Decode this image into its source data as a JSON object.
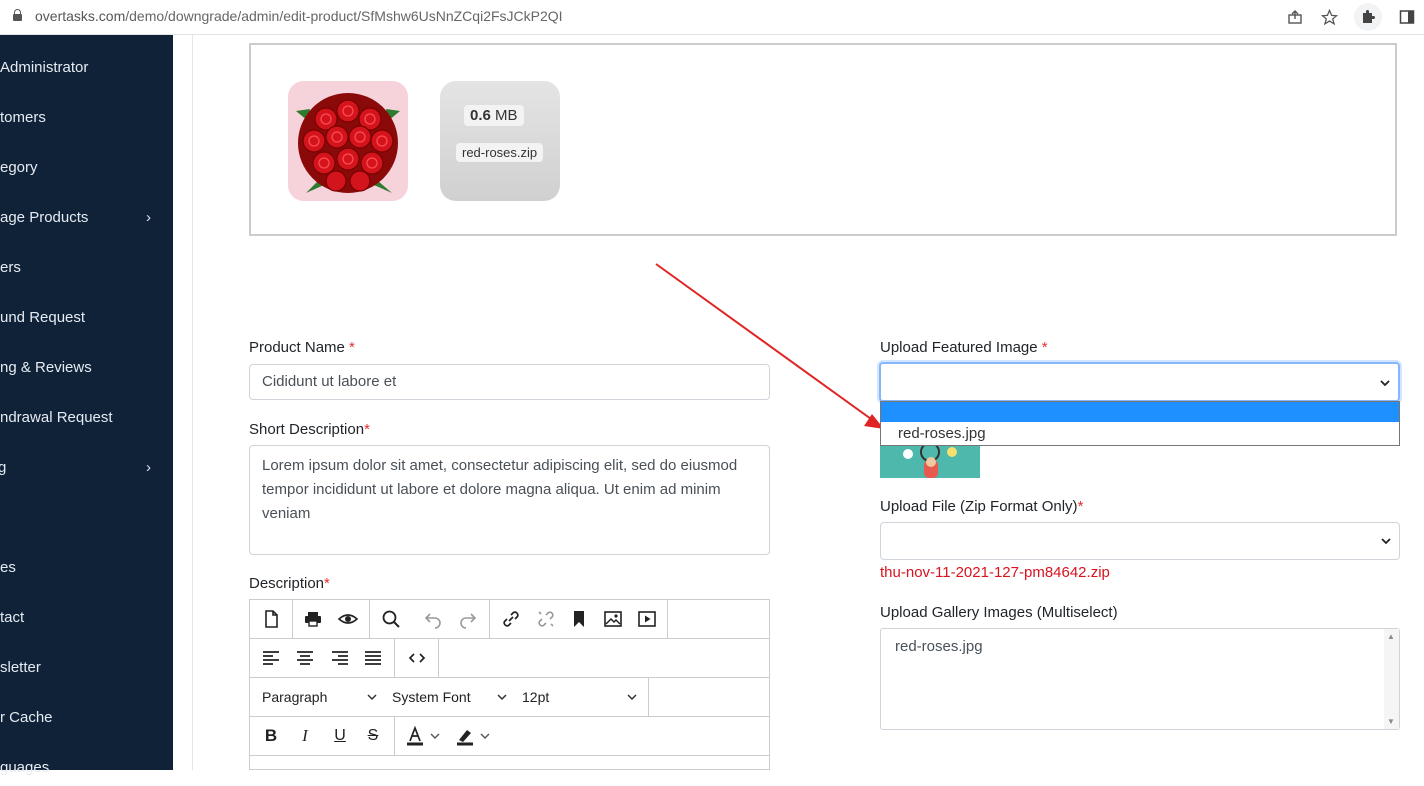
{
  "browser": {
    "url_host": "overtasks.com",
    "url_path": "/demo/downgrade/admin/edit-product/SfMshw6UsNnZCqi2FsJCkP2QI"
  },
  "sidebar": {
    "items": [
      {
        "label": "Administrator"
      },
      {
        "label": "tomers"
      },
      {
        "label": "egory"
      },
      {
        "label": "age Products",
        "chevron": "›"
      },
      {
        "label": "ers"
      },
      {
        "label": "und Request"
      },
      {
        "label": "ng & Reviews"
      },
      {
        "label": "ndrawal Request"
      },
      {
        "label": "",
        "chevron": "›"
      },
      {
        "label": "es"
      },
      {
        "label": "tact"
      },
      {
        "label": "sletter"
      },
      {
        "label": "r Cache"
      },
      {
        "label": "guages"
      }
    ]
  },
  "preview": {
    "file_size_value": "0.6",
    "file_size_unit": "MB",
    "file_name": "red-roses.zip"
  },
  "form": {
    "product_name_label": "Product Name",
    "product_name_value": "Cididunt ut labore et",
    "short_desc_label": "Short Description",
    "short_desc_value": "Lorem ipsum dolor sit amet, consectetur adipiscing elit, sed do eiusmod tempor incididunt ut labore et dolore magna aliqua. Ut enim ad minim veniam",
    "description_label": "Description",
    "featured_label": "Upload Featured Image",
    "featured_options": [
      "",
      "red-roses.jpg"
    ],
    "file_label": "Upload File (Zip Format Only)",
    "file_current": "thu-nov-11-2021-127-pm84642.zip",
    "gallery_label": "Upload Gallery Images (Multiselect)",
    "gallery_options": [
      "red-roses.jpg"
    ],
    "required_mark": "*"
  },
  "editor": {
    "block_format": "Paragraph",
    "font_family": "System Font",
    "font_size": "12pt"
  },
  "colors": {
    "sidebar_bg": "#0f2238",
    "dropdown_highlight": "#1e90ff",
    "required": "#e03131",
    "file_link_red": "#d9121f",
    "arrow": "#e02424"
  }
}
